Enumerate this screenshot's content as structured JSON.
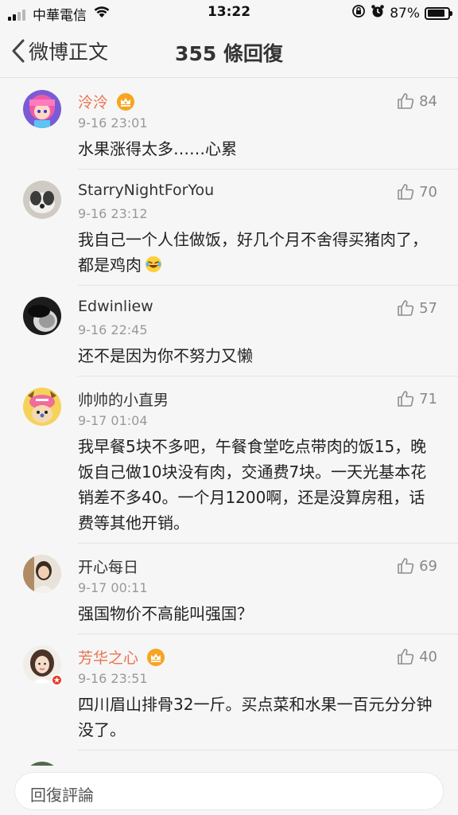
{
  "status_bar": {
    "carrier": "中華電信",
    "time": "13:22",
    "battery_percent": "87%",
    "battery_level": 0.87
  },
  "nav": {
    "back_label": "微博正文",
    "title": "355 條回復"
  },
  "comments": [
    {
      "user": "泠泠",
      "time": "9-16 23:01",
      "likes": "84",
      "text": "水果涨得太多……心累",
      "text2": ""
    },
    {
      "user": "StarryNightForYou",
      "time": "9-16 23:12",
      "likes": "70",
      "text": "我自己一个人住做饭，好几个月不舍得买猪肉了，都是鸡肉",
      "text2": ""
    },
    {
      "user": "Edwinliew",
      "time": "9-16 22:45",
      "likes": "57",
      "text": "还不是因为你不努力又懒",
      "text2": ""
    },
    {
      "user": "帅帅的小直男",
      "time": "9-17 01:04",
      "likes": "71",
      "text": "我早餐5块不多吧，午餐食堂吃点带肉的饭15，晚饭自己做10块没有肉，交通费7块。一天光基本花销差不多40。一个月1200啊，还是没算房租，话费等其他开销。",
      "text2": ""
    },
    {
      "user": "开心每日",
      "time": "9-17 00:11",
      "likes": "69",
      "text": "强国物价不高能叫强国？",
      "text2": ""
    },
    {
      "user": "芳华之心",
      "time": "9-16 23:51",
      "likes": "40",
      "text": "四川眉山排骨32一斤。买点菜和水果一百元分分钟没了。",
      "text2": ""
    }
  ],
  "input": {
    "placeholder": "回復評論"
  },
  "colors": {
    "vip_name": "#eb7350",
    "background": "#f6f6f6",
    "crown": "#f7a521"
  },
  "icons": [
    "signal-icon",
    "wifi-icon",
    "alarm-icon",
    "orientation-lock-icon",
    "battery-icon",
    "back-chevron-icon",
    "thumbs-up-icon",
    "crown-icon",
    "laughing-crying-emoji"
  ]
}
